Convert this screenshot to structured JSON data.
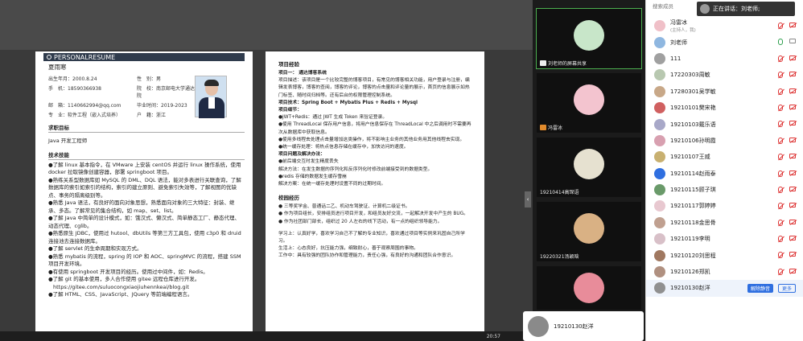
{
  "resume": {
    "banner": "PERSONALRESUME",
    "name": "夏雨寒",
    "info": [
      "出生年月：2000.8.24",
      "性　别：男",
      "手　机：18590366938",
      "院　校：南京邮电大学通达学院",
      "邮　箱：1140662994@qq.com",
      "毕业时间：2019-2023",
      "专　业：软件工程（嵌入式培养）",
      "户　籍：浙江"
    ],
    "objective_title": "求职目标",
    "objective": "Java 开发工程师",
    "skills_title": "技术技能",
    "skills": [
      "●了解 linux 基本指令，在 VMware 上安装 centOS 并运行 linux 操作系统，使用 docker 拉取镜像创建容器，部署 springboot 项目。",
      "●熟练关系型数据库如 MySQL 的 DML、DQL 语法，能对多表进行关联查询，了解数据库的索引如索引的结构，索引的建立原则、避免索引失效等，了解视图的优缺点、事务的隔离级别等。",
      "●熟悉 Java 语法，有良好的面向对象思想，熟悉面向对象的三大特征：封装、继承、多态。了解常见的集合结构，如 map、set、list。",
      "●了解 Java 中简单的设计模式，如：饿汉式、懒汉式、简单静态工厂、静态代理、动态代理、cglib。",
      "●熟悉原生 JDBC，使用过 hutool、dbUtils 等第三方工具包，使用 c3p0 和 druid 连接池去连接数据库。",
      "●了解 servlet 的生命周期和实现方式。",
      "●熟悉 mybatis 的流程，spring 的 IOP 和 AOC、springMVC 的流程，搭建 SSM 项目开发环境。",
      "●有使用 springboot 开发项目的经历。使用过中间件，如：Redis。",
      "●了解 git 的基本使用，多人合作使用 gitee 远程仓库进行开发。",
      "https://gitee.com/suluocongxiaojiuhennkeai/blog.git",
      "●了解 HTML、CSS、JavaScript、JQuery 等前端编程语言。"
    ],
    "project_title": "项目经验",
    "project_lines": [
      "项目一：  通达博客系统",
      "项目描述：该项目是一个比较完整的博客项目，有常见的博客相关功能，用户登录与注册，编辑发表博客，博客的查阅，博客的评论，博客的点击量和评论量的展示，首页的信息展示如热门标签、随时间归档等。还有后台的权限管理控制系统。",
      "项目技术：Spring Boot + Mybatis Plus + Redis + Mysql",
      "项目细节：",
      "●JWT+Redis：通过 JWT 生成 Token 来验证登录。",
      "●使用 ThreadLocal 保存用户信息，将用户信息保存在 ThreadLocal 中之后调用时不需要再次从数据库中获取信息。",
      "●使用多线程去处理点击量增加这类操作，将不影响主业务的其他业务用其他线程去实现。",
      "●统一缓存处理：将热点信息存储在缓存中，加快访问的速度。",
      "项目问题及解决办法：",
      "●前后端交互时发生精度丢失",
      "解决方法：在发生数据的序列化和反序列化时修改前端接受到的数据类型。",
      "●redis 存储的数据发生缓存雪崩",
      "解决方案：在统一缓存处理时设置不同的过期时间。"
    ],
    "school_title": "校园经历",
    "school_lines": [
      "● 三等奖学金、普通话二乙、机动车驾驶证、计算机二级证书。",
      "● 作为项目组长，安排组员进行项目开发，和组员友好交流，一起解决开发中产生的 BUG。",
      "● 作为社团部门部长，组织过 20 人左右的线下活动，有一点的组织领导能力。"
    ],
    "self_lines": [
      "学习上：认真好学，喜欢学习自己不了解的专业知识，喜欢通过项目等实例来巩固自己所学习。",
      "生活上：心态良好，抗压能力强，细致耐心，善于观察周围的事物。",
      "工作中：具有较强的团队协作和管理能力，责任心强，有良好的沟通和团队合作意识。"
    ]
  },
  "video_tiles": [
    {
      "label": "刘老师的屏幕共享",
      "color": "#c8e6c9",
      "active": true
    },
    {
      "label": "冯雷冰",
      "color": "#f3c4cf",
      "active": false
    },
    {
      "label": "19210414高琛语",
      "color": "#e6e1d0",
      "active": false
    },
    {
      "label": "19220321汤颖晗",
      "color": "#d9b184",
      "active": false
    },
    {
      "label": "",
      "color": "#e88c9a",
      "active": false
    }
  ],
  "speaker_bar": {
    "name": "19210130赵洋"
  },
  "speaking": {
    "label": "正在讲话：刘老师;"
  },
  "taskbar_time": "20:57",
  "participants_panel": {
    "search_placeholder": "搜索成员",
    "unmute_label": "解除静音",
    "more_label": "更多",
    "items": [
      {
        "name": "冯雷冰",
        "sub": "(主持人，我)",
        "color": "#f0c0c8",
        "mic": "off",
        "cam": "off"
      },
      {
        "name": "刘老师",
        "sub": "",
        "color": "#8fb7e0",
        "mic": "on",
        "cam": "on"
      },
      {
        "name": "111",
        "sub": "",
        "color": "#a0a0a0",
        "mic": "off",
        "cam": "off"
      },
      {
        "name": "17220303周敏",
        "sub": "",
        "color": "#b8c8b0",
        "mic": "off",
        "cam": "off"
      },
      {
        "name": "17280301吴学敏",
        "sub": "",
        "color": "#c8a888",
        "mic": "off",
        "cam": "off"
      },
      {
        "name": "19210101樊宋艳",
        "sub": "",
        "color": "#d06060",
        "mic": "off",
        "cam": "off"
      },
      {
        "name": "19210103戴乐语",
        "sub": "",
        "color": "#a8a8c8",
        "mic": "off",
        "cam": "off"
      },
      {
        "name": "19210106孙明霞",
        "sub": "",
        "color": "#d8a0b0",
        "mic": "off",
        "cam": "off"
      },
      {
        "name": "19210107王威",
        "sub": "",
        "color": "#c8b070",
        "mic": "off",
        "cam": "off"
      },
      {
        "name": "19210114赵雨泰",
        "sub": "",
        "color": "#2f6fe0",
        "mic": "off",
        "cam": "off"
      },
      {
        "name": "19210115顾子琪",
        "sub": "",
        "color": "#6a9a6a",
        "mic": "off",
        "cam": "off"
      },
      {
        "name": "19210117郭婷婷",
        "sub": "",
        "color": "#e8c8d0",
        "mic": "off",
        "cam": "off"
      },
      {
        "name": "19210118金思骨",
        "sub": "",
        "color": "#c0a090",
        "mic": "off",
        "cam": "off"
      },
      {
        "name": "19210119李明",
        "sub": "",
        "color": "#d8c0c8",
        "mic": "off",
        "cam": "off"
      },
      {
        "name": "19210120刘思程",
        "sub": "",
        "color": "#a07860",
        "mic": "off",
        "cam": "off"
      },
      {
        "name": "19210126郑凯",
        "sub": "",
        "color": "#b09080",
        "mic": "off",
        "cam": "off"
      },
      {
        "name": "19210130赵洋",
        "sub": "",
        "color": "#909090",
        "mic": "off",
        "cam": "off",
        "selected": true
      }
    ]
  }
}
